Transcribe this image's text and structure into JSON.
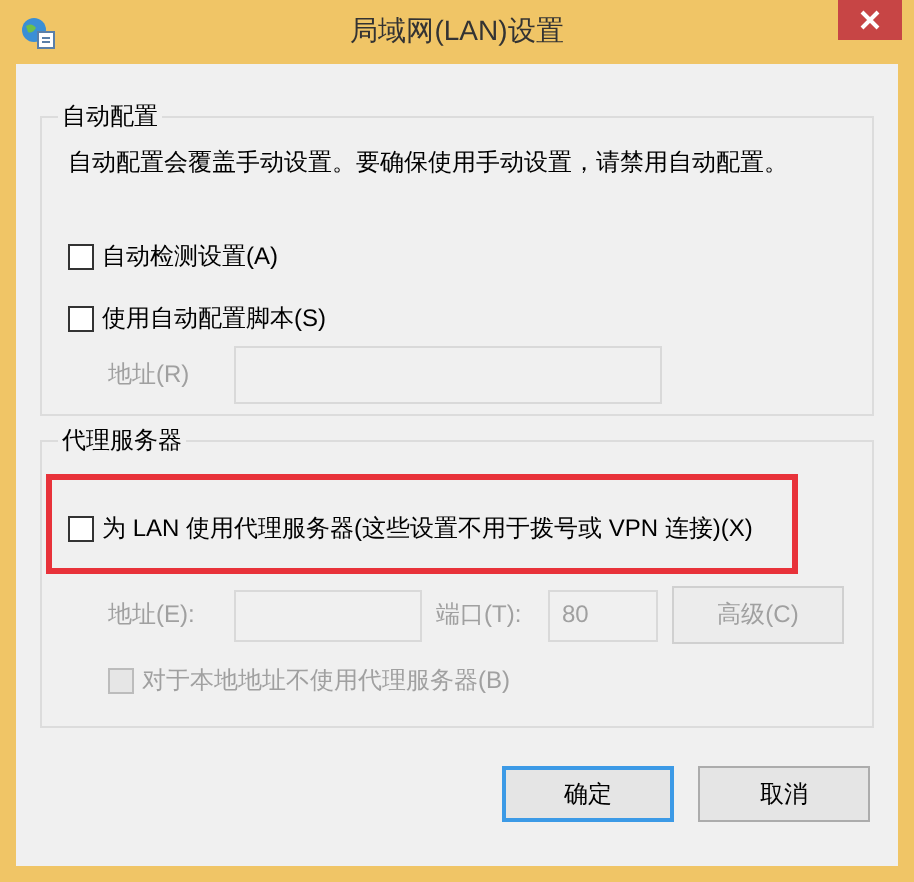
{
  "window": {
    "title": "局域网(LAN)设置"
  },
  "auto_config": {
    "legend": "自动配置",
    "description": "自动配置会覆盖手动设置。要确保使用手动设置，请禁用自动配置。",
    "options": [
      {
        "label": "自动检测设置(A)",
        "checked": false,
        "disabled": false
      },
      {
        "label": "使用自动配置脚本(S)",
        "checked": false,
        "disabled": false
      }
    ],
    "address": {
      "label": "地址(R)",
      "disabled": true
    }
  },
  "proxy": {
    "legend": "代理服务器",
    "use_proxy": {
      "label": "为 LAN 使用代理服务器(这些设置不用于拨号或 VPN 连接)(X)",
      "checked": false,
      "highlighted": true
    },
    "address": {
      "label": "地址(E):",
      "disabled": true
    },
    "port": {
      "label": "端口(T):",
      "value": "80",
      "disabled": true
    },
    "advanced_button": {
      "label": "高级(C)",
      "disabled": true
    },
    "bypass_local": {
      "label": "对于本地地址不使用代理服务器(B)",
      "checked": false,
      "disabled": true
    }
  },
  "buttons": [
    {
      "label": "确定",
      "default": true
    },
    {
      "label": "取消",
      "default": false
    }
  ]
}
